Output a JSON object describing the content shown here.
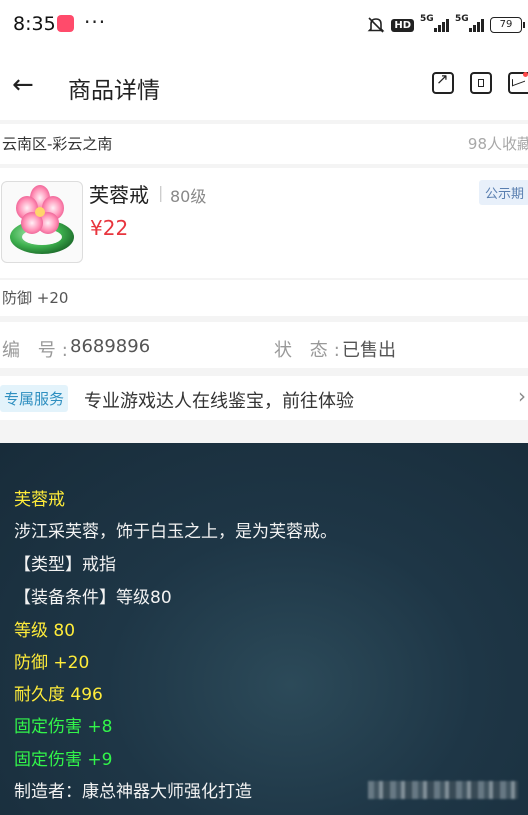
{
  "status_bar": {
    "time": "8:35",
    "more": "···",
    "hd": "HD",
    "net1": "5G",
    "net2": "5G",
    "battery": "79"
  },
  "nav": {
    "back": "←",
    "title": "商品详情"
  },
  "server": {
    "name": "云南区-彩云之南",
    "favorites": "98人收藏"
  },
  "item": {
    "name": "芙蓉戒",
    "separator": "|",
    "level": "80级",
    "price": "¥22",
    "badge": "公示期"
  },
  "attr_strip": {
    "text": "防御 +20"
  },
  "meta": {
    "id_label": "编 号:",
    "id_value": "8689896",
    "state_label": "状 态:",
    "state_value": "已售出"
  },
  "service": {
    "badge": "专属服务",
    "text": "专业游戏达人在线鉴宝，前往体验",
    "arrow": "›"
  },
  "tooltip": {
    "name": "芙蓉戒",
    "desc": "涉江采芙蓉，饰于白玉之上，是为芙蓉戒。",
    "type": "【类型】戒指",
    "requirement": "【装备条件】等级80",
    "level": "等级 80",
    "defense": "防御 +20",
    "durability": "耐久度 496",
    "fixed_damage_1": "固定伤害 +8",
    "fixed_damage_2": "固定伤害 +9",
    "maker": "制造者：康总神器大师强化打造"
  },
  "colors": {
    "price": "#e8353e",
    "tooltip_yellow": "#ffec3a",
    "tooltip_green": "#32f54a",
    "service_blue": "#2e8fc0"
  }
}
